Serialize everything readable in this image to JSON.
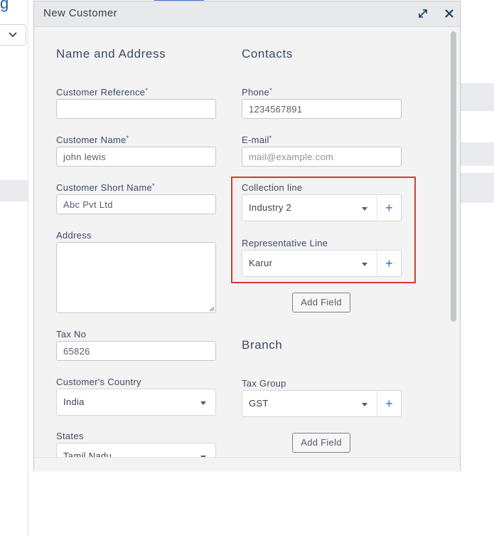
{
  "background": {
    "logo_text": "g"
  },
  "dialog": {
    "title": "New Customer",
    "expand_icon": "expand-arrows-icon",
    "close_icon": "close-icon"
  },
  "name_and_address": {
    "section_title": "Name and Address",
    "customer_reference": {
      "label": "Customer Reference",
      "value": ""
    },
    "customer_name": {
      "label": "Customer Name",
      "value": "john lewis"
    },
    "customer_short_name": {
      "label": "Customer Short Name",
      "value": "Abc Pvt Ltd"
    },
    "address": {
      "label": "Address",
      "value": ""
    },
    "tax_no": {
      "label": "Tax No",
      "value": "65826"
    },
    "customers_country": {
      "label": "Customer's Country",
      "value": "India"
    },
    "states": {
      "label": "States",
      "value": "Tamil Nadu"
    }
  },
  "contacts": {
    "section_title": "Contacts",
    "phone": {
      "label": "Phone",
      "value": "1234567891"
    },
    "email": {
      "label": "E-mail",
      "placeholder": "mail@example.com"
    },
    "collection_line": {
      "label": "Collection line",
      "value": "Industry 2"
    },
    "representative_line": {
      "label": "Representative Line",
      "value": "Karur"
    },
    "add_field_label": "Add Field"
  },
  "branch": {
    "section_title": "Branch",
    "tax_group": {
      "label": "Tax Group",
      "value": "GST"
    },
    "add_field_label": "Add Field"
  },
  "required_marker": "*",
  "plus_symbol": "+",
  "colors": {
    "highlight": "#d93a2b",
    "accent": "#2f6fd1",
    "dialog_bg": "#f3f3f4"
  }
}
